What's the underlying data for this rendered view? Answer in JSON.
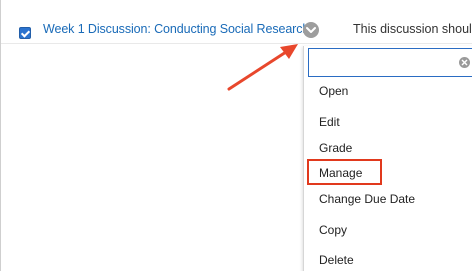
{
  "row": {
    "checked": true,
    "item_title": "Week 1 Discussion: Conducting Social Research",
    "description": "This discussion should"
  },
  "menu": {
    "search": {
      "value": "",
      "placeholder": ""
    },
    "items": [
      {
        "label": "Open"
      },
      {
        "label": "Edit"
      },
      {
        "label": "Grade"
      },
      {
        "label": "Manage"
      },
      {
        "label": "Change Due Date"
      },
      {
        "label": "Copy"
      },
      {
        "label": "Delete"
      }
    ],
    "highlighted_item": "Manage"
  },
  "annotation": {
    "arrow_color": "#e8472c",
    "highlight_color": "#e1391d"
  },
  "colors": {
    "link": "#1a6bb8",
    "checkbox": "#2b73cf",
    "focus_border": "#2a6cc3"
  },
  "icons": {
    "row_options": "chevron-down-icon",
    "search_clear": "clear-icon",
    "checkbox": "checkmark-icon"
  }
}
